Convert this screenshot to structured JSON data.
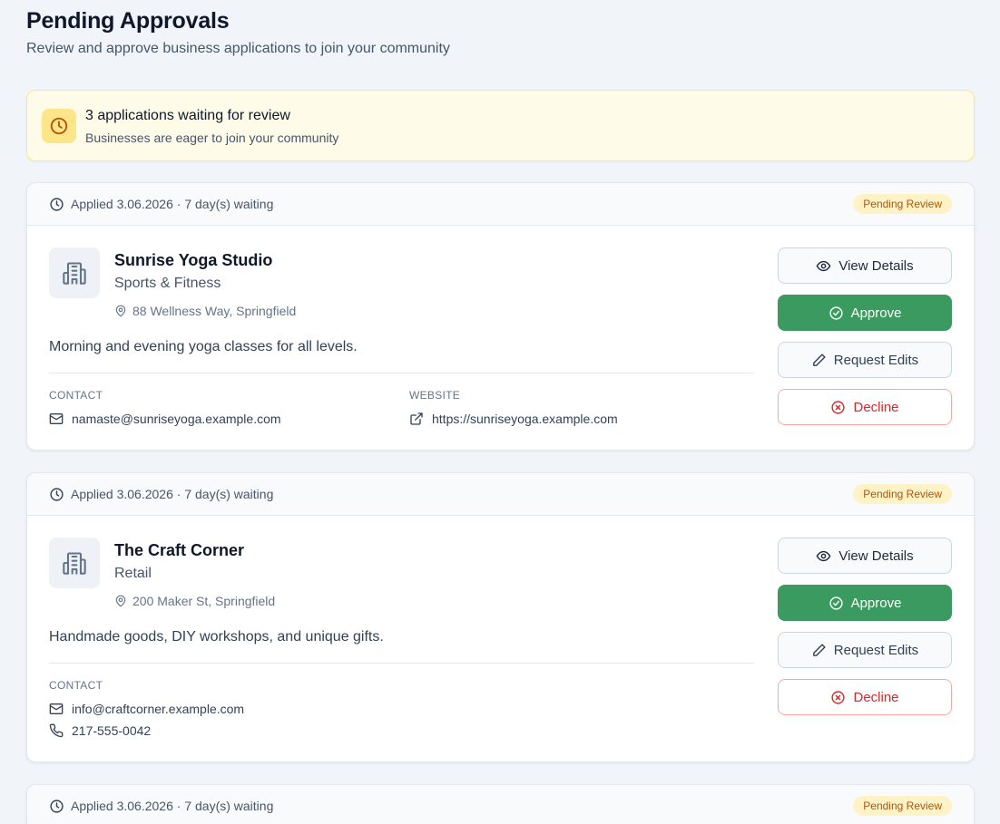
{
  "header": {
    "title": "Pending Approvals",
    "subtitle": "Review and approve business applications to join your community"
  },
  "notice": {
    "title": "3 applications waiting for review",
    "subtitle": "Businesses are eager to join your community"
  },
  "labels": {
    "view_details": "View Details",
    "approve": "Approve",
    "request_edits": "Request Edits",
    "decline": "Decline",
    "contact": "CONTACT",
    "website": "WEBSITE"
  },
  "applications": [
    {
      "applied": "Applied 3.06.2026 · 7 day(s) waiting",
      "status": "Pending Review",
      "name": "Sunrise Yoga Studio",
      "category": "Sports & Fitness",
      "address": "88 Wellness Way, Springfield",
      "description": "Morning and evening yoga classes for all levels.",
      "email": "namaste@sunriseyoga.example.com",
      "website": "https://sunriseyoga.example.com"
    },
    {
      "applied": "Applied 3.06.2026 · 7 day(s) waiting",
      "status": "Pending Review",
      "name": "The Craft Corner",
      "category": "Retail",
      "address": "200 Maker St, Springfield",
      "description": "Handmade goods, DIY workshops, and unique gifts.",
      "email": "info@craftcorner.example.com",
      "phone": "217-555-0042"
    },
    {
      "applied": "Applied 3.06.2026 · 7 day(s) waiting",
      "status": "Pending Review"
    }
  ],
  "colors": {
    "approve": "#3a9a5f",
    "decline": "#dc2626",
    "badge_bg": "#fef3c7",
    "badge_text": "#b45309",
    "notice_bg": "#fefce8"
  }
}
